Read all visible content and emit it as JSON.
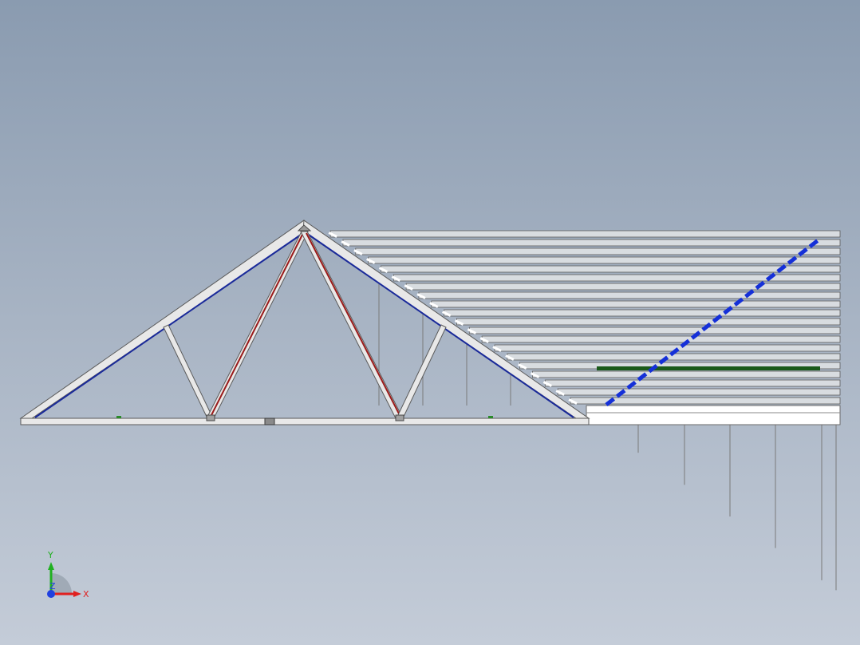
{
  "viewport": {
    "background_top": "#8a9bb0",
    "background_bottom": "#c4ccd8"
  },
  "model": {
    "colors": {
      "member_fill": "#e8e8e8",
      "member_edge": "#5a5a5a",
      "chord_blue": "#1a2a9a",
      "web_red": "#9a1a1a",
      "brace_blue": "#1530d8",
      "strip_green": "#1a5a1a",
      "purlin_fill": "#d8dce0"
    }
  },
  "triad": {
    "x_label": "X",
    "y_label": "Y",
    "z_label": "Z",
    "x_color": "#e02020",
    "y_color": "#20b020",
    "z_color": "#2040e0"
  }
}
